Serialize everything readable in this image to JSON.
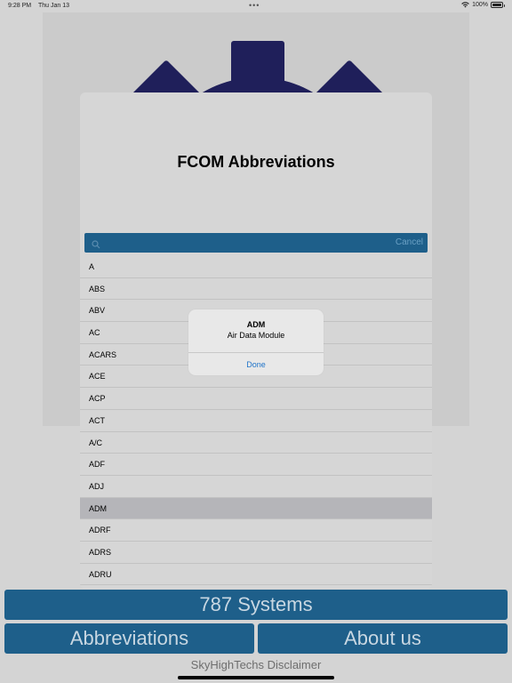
{
  "status": {
    "time": "9:28 PM",
    "date": "Thu Jan 13",
    "battery": "100%"
  },
  "colors": {
    "accent": "#1e5f8a",
    "gear": "#1f1f5a",
    "link": "#1f73c8"
  },
  "modal": {
    "title": "FCOM Abbreviations",
    "search": {
      "value": "",
      "placeholder": "",
      "cancel_label": "Cancel",
      "icon": "search-icon"
    },
    "items": [
      {
        "label": "A"
      },
      {
        "label": "ABS"
      },
      {
        "label": "ABV"
      },
      {
        "label": "AC"
      },
      {
        "label": "ACARS"
      },
      {
        "label": "ACE"
      },
      {
        "label": "ACP"
      },
      {
        "label": "ACT"
      },
      {
        "label": "A/C"
      },
      {
        "label": "ADF"
      },
      {
        "label": "ADJ"
      },
      {
        "label": "ADM"
      },
      {
        "label": "ADRF"
      },
      {
        "label": "ADRS"
      },
      {
        "label": "ADRU"
      }
    ],
    "selected_index": 11
  },
  "alert": {
    "title": "ADM",
    "message": "Air Data Module",
    "button_label": "Done"
  },
  "buttons": {
    "systems": "787 Systems",
    "abbreviations": "Abbreviations",
    "about": "About us"
  },
  "disclaimer": "SkyHighTechs Disclaimer"
}
